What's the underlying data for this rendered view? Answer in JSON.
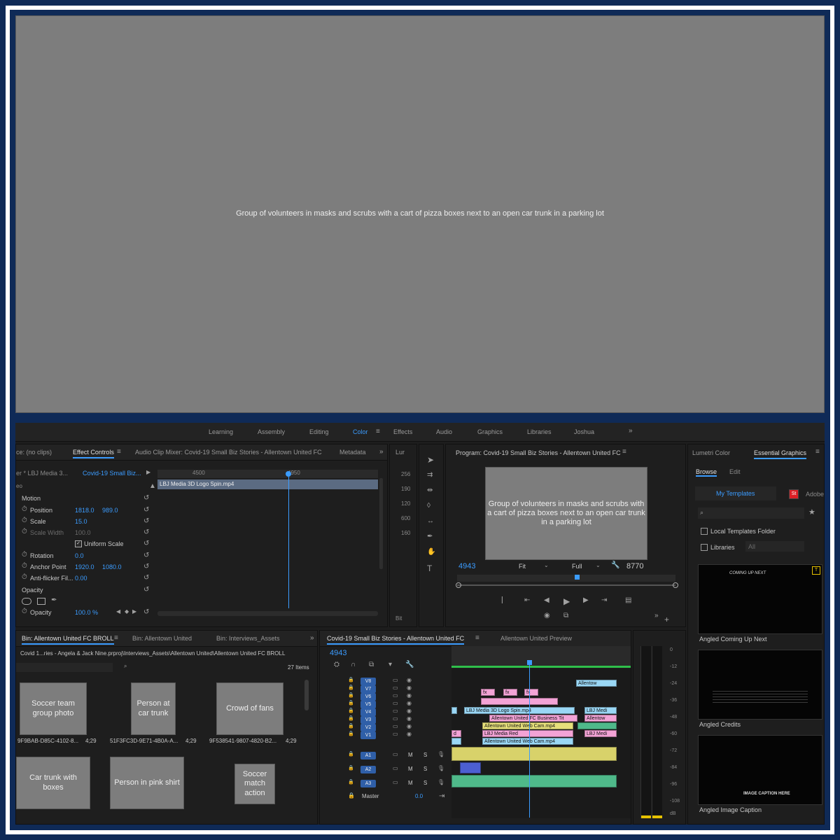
{
  "photo": {
    "alt": "Group of volunteers in masks and scrubs with a cart of pizza boxes next to an open car trunk in a parking lot"
  },
  "workspaces": [
    {
      "label": "Learning",
      "active": false
    },
    {
      "label": "Assembly",
      "active": false
    },
    {
      "label": "Editing",
      "active": false
    },
    {
      "label": "Color",
      "active": true
    },
    {
      "label": "Effects",
      "active": false
    },
    {
      "label": "Audio",
      "active": false
    },
    {
      "label": "Graphics",
      "active": false
    },
    {
      "label": "Libraries",
      "active": false
    },
    {
      "label": "Joshua",
      "active": false
    }
  ],
  "source_panel": {
    "tabs": [
      "ce: (no clips)",
      "Effect Controls",
      "Audio Clip Mixer: Covid-19 Small Biz Stories - Allentown United FC",
      "Metadata"
    ],
    "master_clip": "er * LBJ Media 3...",
    "sequence_clip": "Covid-19 Small Biz...",
    "ruler": [
      "4500",
      "4950"
    ],
    "clip_bar_name": "LBJ Media 3D Logo Spin.mp4",
    "section_label": "eo",
    "properties": [
      {
        "name": "Motion",
        "values": []
      },
      {
        "name": "Position",
        "values": [
          "1818.0",
          "989.0"
        ]
      },
      {
        "name": "Scale",
        "values": [
          "15.0"
        ]
      },
      {
        "name": "Scale Width",
        "values": [
          "100.0"
        ]
      },
      {
        "name": "Uniform Scale",
        "values": []
      },
      {
        "name": "Rotation",
        "values": [
          "0.0"
        ]
      },
      {
        "name": "Anchor Point",
        "values": [
          "1920.0",
          "1080.0"
        ]
      },
      {
        "name": "Anti-flicker Fil...",
        "values": [
          "0.00"
        ]
      },
      {
        "name": "Opacity",
        "values": []
      },
      {
        "name": "Opacity",
        "values": [
          "100.0 %"
        ]
      }
    ]
  },
  "lumetri_scopes": {
    "title": "Lur",
    "values": [
      "256",
      "190",
      "120",
      "600",
      "160"
    ],
    "footer": "Bit"
  },
  "program_monitor": {
    "title": "Program: Covid-19 Small Biz Stories - Allentown United FC",
    "timecode": "4943",
    "fit": "Fit",
    "quality": "Full",
    "duration": "8770"
  },
  "right_panel": {
    "tabs": [
      "Lumetri Color",
      "Essential Graphics"
    ],
    "subtabs": [
      "Browse",
      "Edit"
    ],
    "templates_tab": "My Templates",
    "adobe_tab": "Adobe",
    "checkbox_local": "Local Templates Folder",
    "checkbox_libraries": "Libraries",
    "libraries_select": "All",
    "templates": [
      {
        "name": "Angled Coming Up Next",
        "preview_text": "COMING UP NEXT"
      },
      {
        "name": "Angled Credits",
        "preview_text": ""
      },
      {
        "name": "Angled Image Caption",
        "preview_text": "IMAGE CAPTION HERE"
      }
    ]
  },
  "bin_panel": {
    "tabs": [
      "Bin: Allentown United FC BROLL",
      "Bin: Allentown United",
      "Bin: Interviews_Assets"
    ],
    "path": "Covid 1...ries - Angela & Jack Nine.prproj\\Interviews_Assets\\Allentown United\\Allentown United FC BROLL",
    "item_count": "27 Items",
    "thumbs": [
      {
        "label": "9F9BAB-D85C-4102-8...",
        "duration": "4;29",
        "alt": "Soccer team group photo"
      },
      {
        "label": "51F3FC3D-9E71-4B0A-A...",
        "duration": "4;29",
        "alt": "Person at car trunk"
      },
      {
        "label": "9F538541-9807-4820-B2...",
        "duration": "4;29",
        "alt": "Crowd of fans"
      },
      {
        "label": "",
        "duration": "",
        "alt": "Car trunk with boxes"
      },
      {
        "label": "",
        "duration": "",
        "alt": "Person in pink shirt"
      },
      {
        "label": "",
        "duration": "",
        "alt": "Soccer match action"
      }
    ]
  },
  "timeline": {
    "tabs": [
      "Covid-19 Small Biz Stories - Allentown United FC",
      "Allentown United Preview"
    ],
    "timecode": "4943",
    "db_scale": [
      "0",
      "-12",
      "-24",
      "-36",
      "-48",
      "-60",
      "-72",
      "-84",
      "-96",
      "-108",
      "dB"
    ],
    "video_tracks": [
      "V8",
      "V7",
      "V6",
      "V5",
      "V4",
      "V3",
      "V2",
      "V1"
    ],
    "audio_tracks": [
      "A1",
      "A2",
      "A3"
    ],
    "mute": "M",
    "solo": "S",
    "master_label": "Master",
    "master_value": "0.0",
    "clips": {
      "allentow": "Allentow",
      "lbj_spin": "LBJ Media 3D Logo Spin.mp4",
      "lbj_medi": "LBJ Medi",
      "biz_tit": "Allentown United FC Business Tit",
      "allentow2": "Allentow",
      "webcam": "Allentown United Web Cam.mp4",
      "lbj_red": "LBJ Media Red",
      "lbj_medi2": "LBJ Medi",
      "webcam2": "Allentown United Web Cam.mp4",
      "d": "d",
      "fx": "fx"
    }
  },
  "colors": {
    "accent": "#3b9cff",
    "frame": "#0f2a57",
    "panel": "#1e1e1e",
    "clip_pink": "#f3a3d6",
    "clip_blue": "#9ad7f5",
    "clip_yellow": "#e6e07a",
    "clip_green": "#4fb98a"
  }
}
